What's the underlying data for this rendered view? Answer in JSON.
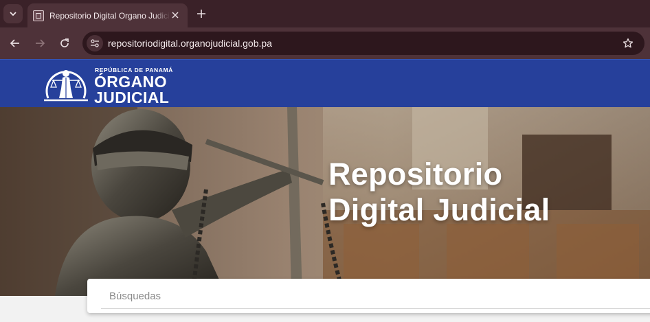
{
  "browser": {
    "tab": {
      "title": "Repositorio Digital Organo Judicial"
    },
    "address_bar": {
      "url": "repositoriodigital.organojudicial.gob.pa"
    }
  },
  "header": {
    "logo": {
      "country_line": "REPÚBLICA DE PANAMÁ",
      "name_line1": "ÓRGANO",
      "name_line2": "JUDICIAL"
    }
  },
  "hero": {
    "title_line1": "Repositorio",
    "title_line2": "Digital Judicial"
  },
  "search": {
    "placeholder": "Búsquedas"
  },
  "colors": {
    "header_blue": "#26409b",
    "browser_frame": "#3a2128"
  }
}
